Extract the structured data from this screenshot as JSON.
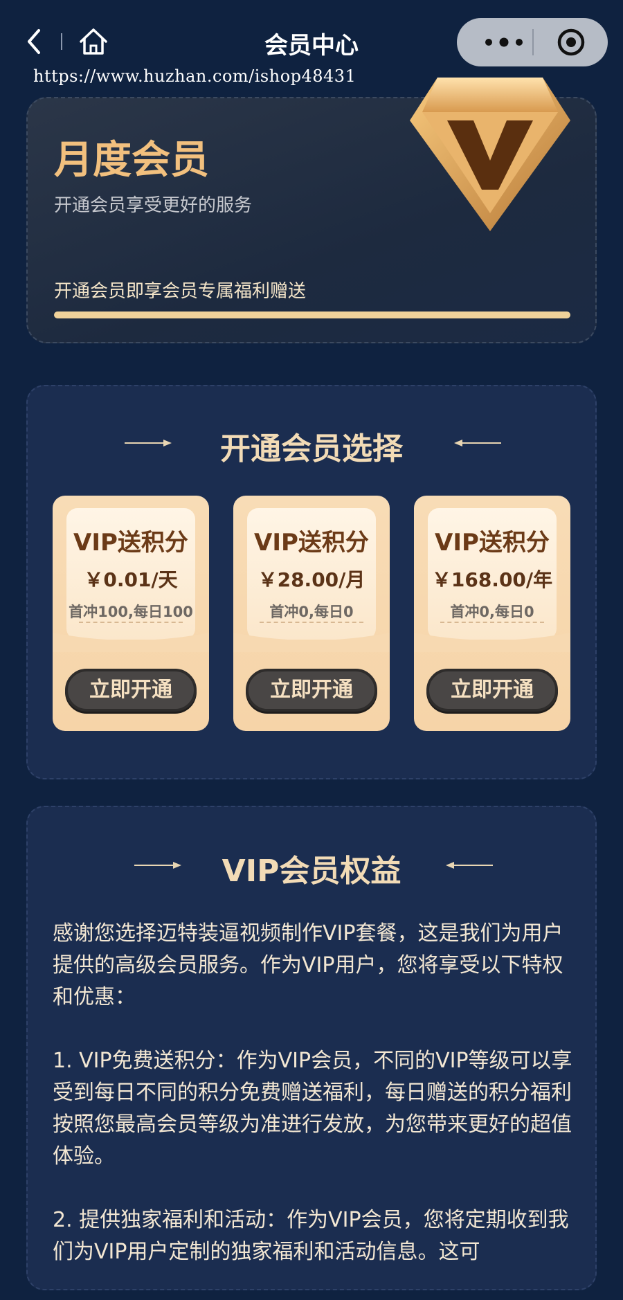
{
  "nav": {
    "title": "会员中心"
  },
  "watermark": "https://www.huzhan.com/ishop48431",
  "month_card": {
    "title": "月度会员",
    "subtitle": "开通会员享受更好的服务",
    "benefit_line": "开通会员即享会员专属福利赠送",
    "progress": 1.0
  },
  "choose": {
    "title": "开通会员选择",
    "plans": [
      {
        "name": "VIP送积分",
        "price": "￥0.01/天",
        "desc": "首冲100,每日100",
        "button": "立即开通"
      },
      {
        "name": "VIP送积分",
        "price": "￥28.00/月",
        "desc": "首冲0,每日0",
        "button": "立即开通"
      },
      {
        "name": "VIP送积分",
        "price": "￥168.00/年",
        "desc": "首冲0,每日0",
        "button": "立即开通"
      }
    ]
  },
  "benefits": {
    "title": "VIP会员权益",
    "intro": "感谢您选择迈特装逼视频制作VIP套餐，这是我们为用户提供的高级会员服务。作为VIP用户，您将享受以下特权和优惠：",
    "item1": "1. VIP免费送积分：作为VIP会员，不同的VIP等级可以享受到每日不同的积分免费赠送福利，每日赠送的积分福利按照您最高会员等级为准进行发放，为您带来更好的超值体验。",
    "item2": "2. 提供独家福利和活动：作为VIP会员，您将定期收到我们为VIP用户定制的独家福利和活动信息。这可"
  },
  "colors": {
    "background": "#0f2240",
    "gold": "#f2c07e",
    "panel": "#1b2d50"
  }
}
